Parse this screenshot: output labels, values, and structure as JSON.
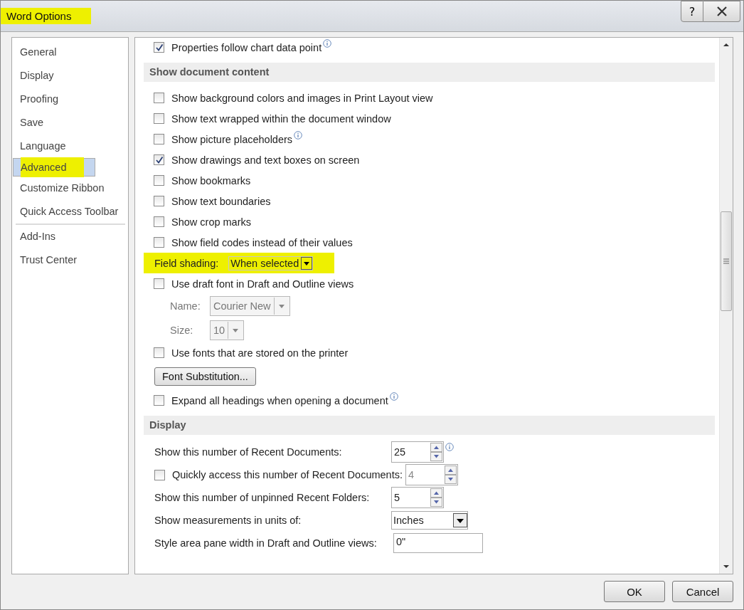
{
  "window": {
    "title": "Word Options",
    "title_highlighted": true,
    "help_button": "?"
  },
  "sidebar": {
    "groups": [
      [
        {
          "label": "General",
          "selected": false,
          "highlighted": false
        },
        {
          "label": "Display",
          "selected": false,
          "highlighted": false
        },
        {
          "label": "Proofing",
          "selected": false,
          "highlighted": false
        },
        {
          "label": "Save",
          "selected": false,
          "highlighted": false
        },
        {
          "label": "Language",
          "selected": false,
          "highlighted": false
        },
        {
          "label": "Advanced",
          "selected": true,
          "highlighted": true
        },
        {
          "label": "Customize Ribbon",
          "selected": false,
          "highlighted": false
        },
        {
          "label": "Quick Access Toolbar",
          "selected": false,
          "highlighted": false
        }
      ],
      [
        {
          "label": "Add-Ins",
          "selected": false,
          "highlighted": false
        },
        {
          "label": "Trust Center",
          "selected": false,
          "highlighted": false
        }
      ]
    ]
  },
  "content": {
    "rows": [
      {
        "kind": "checkbox",
        "label": "Properties follow chart data point",
        "checked": true,
        "info": true
      },
      {
        "kind": "header",
        "label": "Show document content"
      },
      {
        "kind": "checkbox",
        "label": "Show background colors and images in Print Layout view",
        "checked": false,
        "info": false
      },
      {
        "kind": "checkbox",
        "label": "Show text wrapped within the document window",
        "checked": false,
        "info": false
      },
      {
        "kind": "checkbox",
        "label": "Show picture placeholders",
        "checked": false,
        "info": true
      },
      {
        "kind": "checkbox",
        "label": "Show drawings and text boxes on screen",
        "checked": true,
        "info": false
      },
      {
        "kind": "checkbox",
        "label": "Show bookmarks",
        "checked": false,
        "info": false
      },
      {
        "kind": "checkbox",
        "label": "Show text boundaries",
        "checked": false,
        "info": false
      },
      {
        "kind": "checkbox",
        "label": "Show crop marks",
        "checked": false,
        "info": false
      },
      {
        "kind": "checkbox",
        "label": "Show field codes instead of their values",
        "checked": false,
        "info": false
      },
      {
        "kind": "dropdown",
        "label": "Field shading:",
        "value": "When selected",
        "highlighted": true
      },
      {
        "kind": "checkbox",
        "label": "Use draft font in Draft and Outline views",
        "checked": false,
        "info": false
      },
      {
        "kind": "subdropdown",
        "label": "Name:",
        "value": "Courier New",
        "disabled": true
      },
      {
        "kind": "subdropdown",
        "label": "Size:",
        "value": "10",
        "disabled": true
      },
      {
        "kind": "checkbox",
        "label": "Use fonts that are stored on the printer",
        "checked": false,
        "info": false
      },
      {
        "kind": "button",
        "label": "Font Substitution..."
      },
      {
        "kind": "checkbox",
        "label": "Expand all headings when opening a document",
        "checked": false,
        "info": true
      },
      {
        "kind": "header",
        "label": "Display"
      },
      {
        "kind": "spin",
        "label": "Show this number of Recent Documents:",
        "value": "25",
        "info": true
      },
      {
        "kind": "checkspin",
        "label": "Quickly access this number of Recent Documents:",
        "checked": false,
        "value": "4",
        "disabled": true
      },
      {
        "kind": "spin",
        "label": "Show this number of unpinned Recent Folders:",
        "value": "5",
        "info": false
      },
      {
        "kind": "select",
        "label": "Show measurements in units of:",
        "value": "Inches"
      },
      {
        "kind": "text",
        "label": "Style area pane width in Draft and Outline views:",
        "value": "0\""
      }
    ]
  },
  "buttons": [
    "OK",
    "Cancel"
  ]
}
